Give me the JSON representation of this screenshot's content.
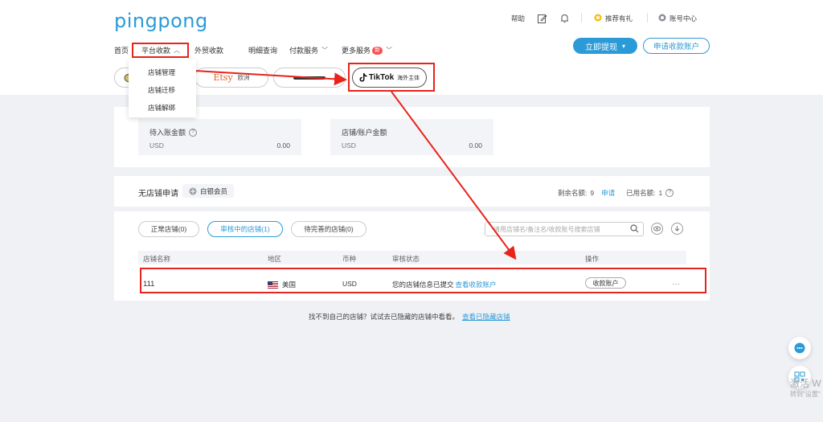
{
  "header": {
    "logo": "pingpong",
    "help": "帮助",
    "referral": "推荐有礼",
    "account_center": "账号中心",
    "nav": [
      {
        "label": "首页"
      },
      {
        "label": "平台收款"
      },
      {
        "label": "外贸收款"
      },
      {
        "label": "明细查询"
      },
      {
        "label": "付款服务"
      },
      {
        "label": "更多服务"
      }
    ],
    "new_badge": "新",
    "withdraw_button": "立即提现",
    "apply_account_button": "申请收款账户"
  },
  "dropdown": {
    "items": [
      {
        "label": "店铺管理"
      },
      {
        "label": "店铺迁移"
      },
      {
        "label": "店铺解绑"
      }
    ]
  },
  "platforms": {
    "etsy": "Etsy",
    "etsy_region": "欧洲",
    "tiktok": "TikTok",
    "tiktok_region": "海外主体"
  },
  "balances": {
    "pending": {
      "label": "待入账金额",
      "currency": "USD",
      "amount": "0.00"
    },
    "store_account": {
      "label": "店铺/账户金额",
      "currency": "USD",
      "amount": "0.00"
    }
  },
  "no_store": {
    "title": "无店铺申请",
    "member": "白银会员",
    "remaining_label": "剩余名额:",
    "remaining_value": "9",
    "apply_link": "申请",
    "used_label": "已用名额:",
    "used_value": "1"
  },
  "tabs": [
    {
      "label": "正常店铺(0)"
    },
    {
      "label": "审核中的店铺(1)"
    },
    {
      "label": "待完善的店铺(0)"
    }
  ],
  "search": {
    "placeholder": "请用店铺名/备注名/收款账号搜索店铺"
  },
  "table": {
    "columns": [
      "店铺名称",
      "地区",
      "币种",
      "审核状态",
      "操作"
    ],
    "rows": [
      {
        "name": "111",
        "region": "美国",
        "currency": "USD",
        "status": "您的店铺信息已提交",
        "status_link": "查看收款账户",
        "action": "收款账户",
        "more": "···"
      }
    ]
  },
  "footer": {
    "text": "找不到自己的店铺？试试去已隐藏的店铺中看看。",
    "link": "查看已隐藏店铺"
  },
  "watermark": {
    "line1": "激活 W",
    "line2": "转到\"设置\""
  },
  "colors": {
    "brand": "#2b9bd8",
    "annotation_red": "#e8231b"
  }
}
